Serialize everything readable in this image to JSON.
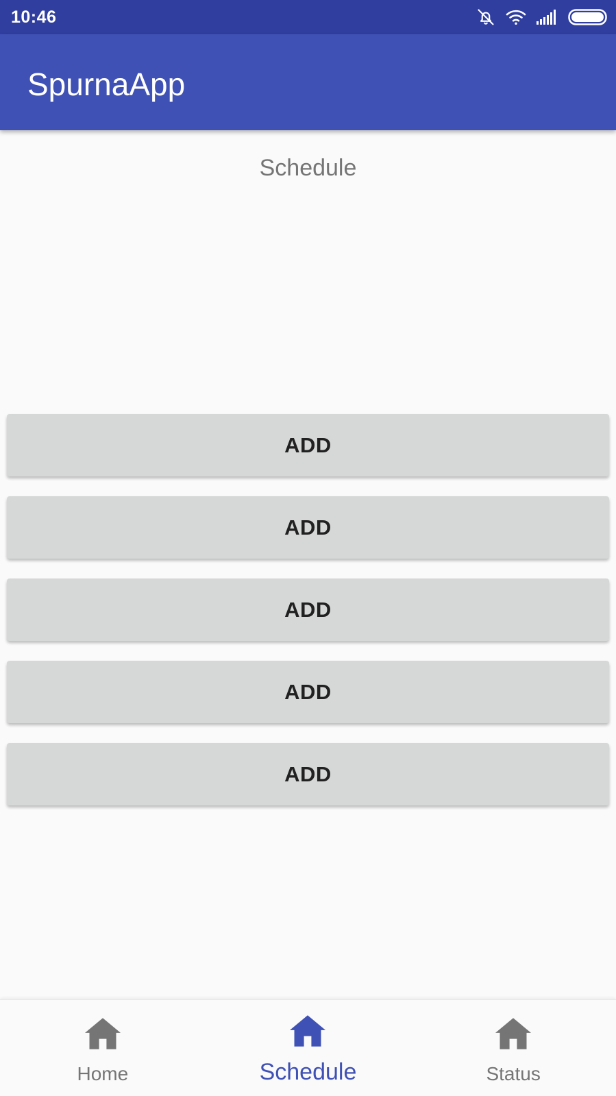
{
  "status_bar": {
    "time": "10:46",
    "icons": [
      "notifications-off-icon",
      "wifi-icon",
      "signal-icon",
      "battery-icon"
    ]
  },
  "app_bar": {
    "title": "SpurnaApp",
    "color": "#3f51b5"
  },
  "page": {
    "section_label": "Schedule"
  },
  "buttons": [
    {
      "label": "ADD"
    },
    {
      "label": "ADD"
    },
    {
      "label": "ADD"
    },
    {
      "label": "ADD"
    },
    {
      "label": "ADD"
    }
  ],
  "bottom_nav": {
    "active_color": "#3f51b5",
    "inactive_color": "#757575",
    "items": [
      {
        "label": "Home",
        "icon": "home-icon",
        "active": false
      },
      {
        "label": "Schedule",
        "icon": "home-icon",
        "active": true
      },
      {
        "label": "Status",
        "icon": "home-icon",
        "active": false
      }
    ]
  }
}
